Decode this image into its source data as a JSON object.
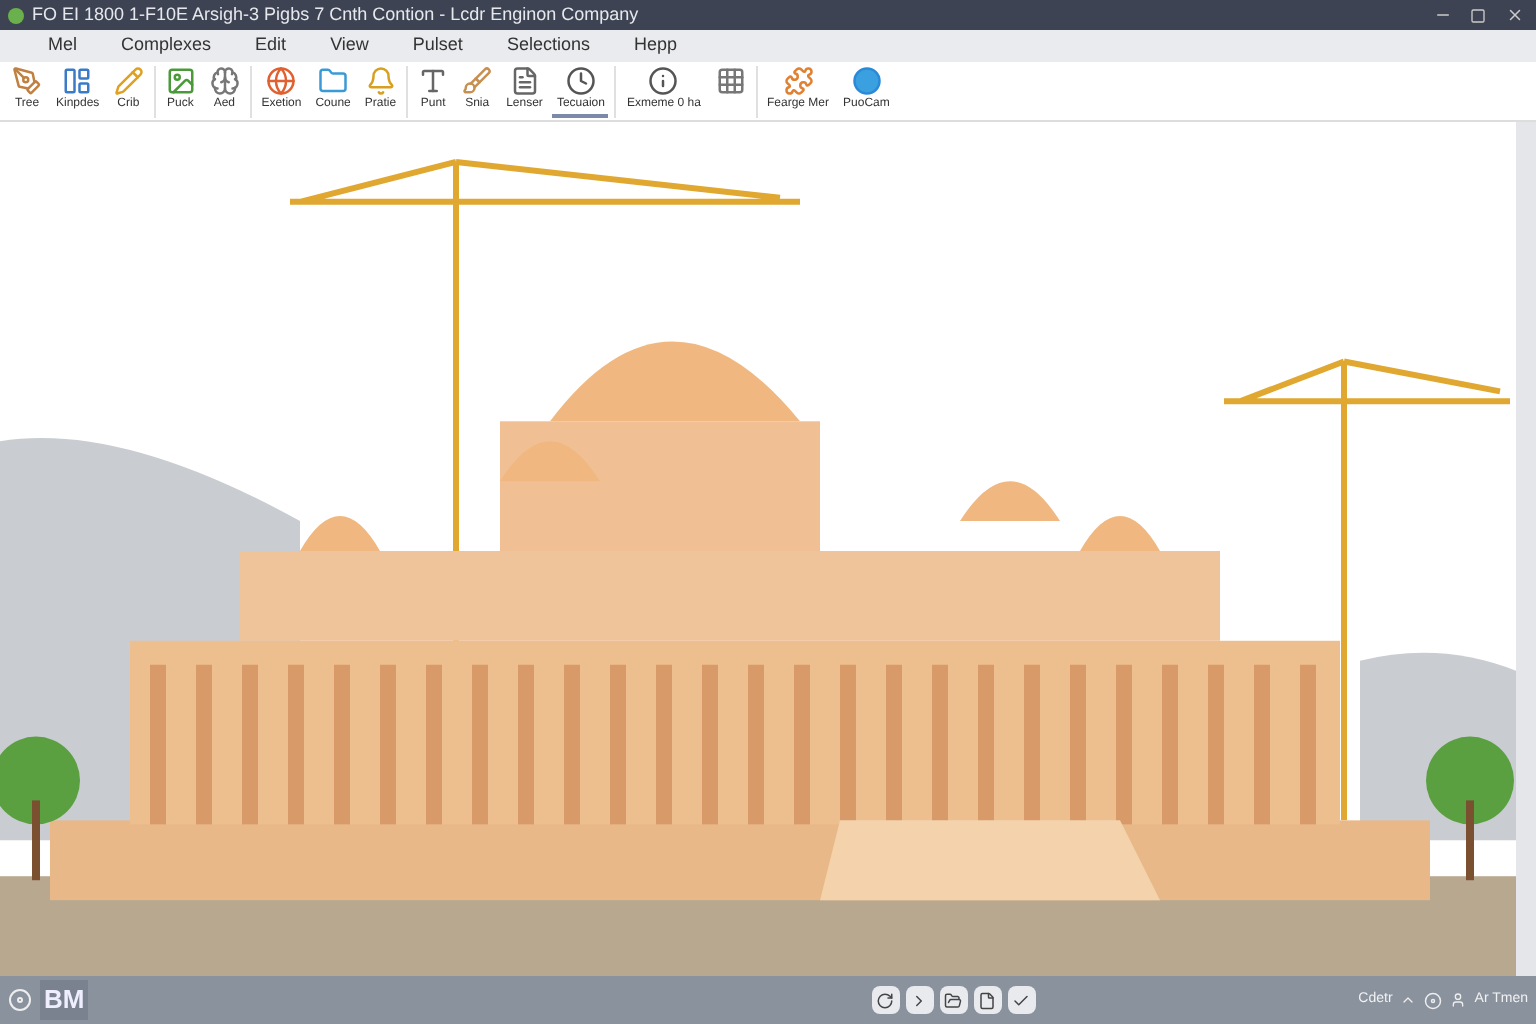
{
  "window": {
    "title": "FO EI 1800 1-F10E Arsigh-3 Pigbs 7 Cnth Contion - Lcdr Enginon Company"
  },
  "menu": [
    "Mel",
    "Complexes",
    "Edit",
    "View",
    "Pulset",
    "Selections",
    "Hepp"
  ],
  "toolbar": [
    {
      "kind": "tool",
      "label": "Tree",
      "selected": false
    },
    {
      "kind": "tool",
      "label": "Kinpdes",
      "selected": false
    },
    {
      "kind": "tool",
      "label": "Crib",
      "selected": false
    },
    {
      "kind": "sep"
    },
    {
      "kind": "tool",
      "label": "Puck",
      "selected": false
    },
    {
      "kind": "tool",
      "label": "Aed",
      "selected": false
    },
    {
      "kind": "sep"
    },
    {
      "kind": "tool",
      "label": "Exetion",
      "selected": false
    },
    {
      "kind": "tool",
      "label": "Coune",
      "selected": false
    },
    {
      "kind": "tool",
      "label": "Pratie",
      "selected": false
    },
    {
      "kind": "sep"
    },
    {
      "kind": "tool",
      "label": "Punt",
      "selected": false
    },
    {
      "kind": "tool",
      "label": "Snia",
      "selected": false
    },
    {
      "kind": "tool",
      "label": "Lenser",
      "selected": false
    },
    {
      "kind": "tool",
      "label": "Tecuaion",
      "selected": true
    },
    {
      "kind": "sep"
    },
    {
      "kind": "tool",
      "label": "Exmeme 0 ha",
      "selected": false
    },
    {
      "kind": "tool",
      "selected": false
    },
    {
      "kind": "sep"
    },
    {
      "kind": "tool",
      "label": "Fearge Mer",
      "selected": false
    },
    {
      "kind": "tool",
      "label": "PuoCam",
      "selected": false
    }
  ],
  "status_bar": {
    "logo": "BM",
    "right_text": "Cdetr",
    "right_text_2": "Ar Tmen"
  }
}
